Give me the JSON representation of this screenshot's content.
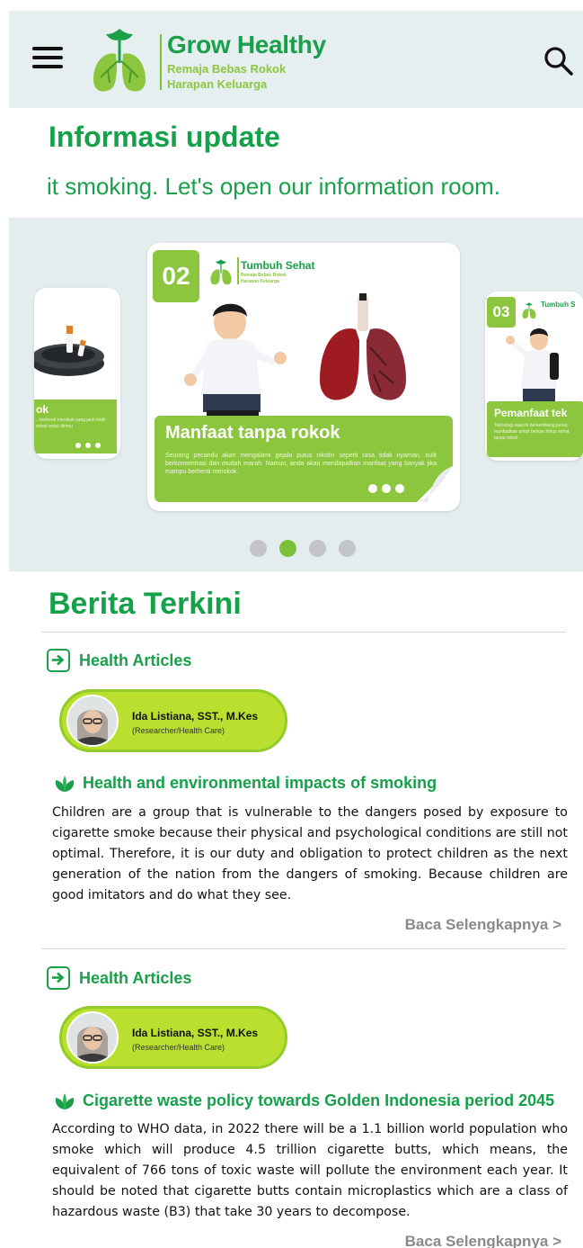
{
  "header": {
    "brand_title": "Grow Healthy",
    "brand_sub_1": "Remaja Bebas Rokok",
    "brand_sub_2": "Harapan Keluarga",
    "menu_icon": "hamburger-menu-icon",
    "search_icon": "search-icon"
  },
  "info": {
    "title": "Informasi update",
    "marquee": "it smoking. Let's open our information room."
  },
  "carousel": {
    "left_card": {
      "banner_title": "ok",
      "banner_text": "...berhenti merokok yang jauh lebih sehat untuk dirimu"
    },
    "main_card": {
      "number": "02",
      "brand": "Tumbuh Sehat",
      "brand_sub_1": "Remaja Bebas Rokok",
      "brand_sub_2": "Harapan Keluarga",
      "banner_title": "Manfaat tanpa rokok",
      "banner_text": "Seorang pecandu akan mengalami gejala putus nikotin seperti rasa tidak nyaman, sulit berkonsentrasi dan mudah marah. Namun, anda akan mendapatkan manfaat yang banyak jika mampu berhenti merokok."
    },
    "right_card": {
      "number": "03",
      "brand": "Tumbuh S",
      "banner_title": "Pemanfaat tek",
      "banner_text": "Teknologi saat ini berkembang pesat, manfaatkan untuk belajar hidup sehat tanpa rokok"
    },
    "active_slide": 2,
    "slide_count": 4
  },
  "news": {
    "title": "Berita Terkini",
    "articles": [
      {
        "category": "Health Articles",
        "author_name": "Ida Listiana, SST., M.Kes",
        "author_role": "(Researcher/Health Care)",
        "title": "Health and environmental impacts of smoking",
        "body": "Children are a group that is vulnerable to the dangers posed by exposure to cigarette smoke because their physical and psychological conditions are still not optimal. Therefore, it is our duty and obligation to protect children as the next generation of the nation from the dangers of smoking. Because children are good imitators and do what they see.",
        "read_more": "Baca Selengkapnya >"
      },
      {
        "category": "Health Articles",
        "author_name": "Ida Listiana, SST., M.Kes",
        "author_role": "(Researcher/Health Care)",
        "title": "Cigarette waste policy towards Golden Indonesia period 2045",
        "body": "According to WHO data, in 2022 there will be a 1.1 billion world population who smoke which will produce 4.5 trillion cigarette butts, which means, the equivalent of 766 tons of toxic waste will pollute the environment each year. It should be noted that cigarette butts contain microplastics which are a class of hazardous waste (B3) that take 30 years to decompose.",
        "read_more": "Baca Selengkapnya >"
      }
    ]
  },
  "colors": {
    "brand_green": "#1aa04a",
    "lime": "#8cc63f",
    "header_bg": "#e6efef"
  }
}
